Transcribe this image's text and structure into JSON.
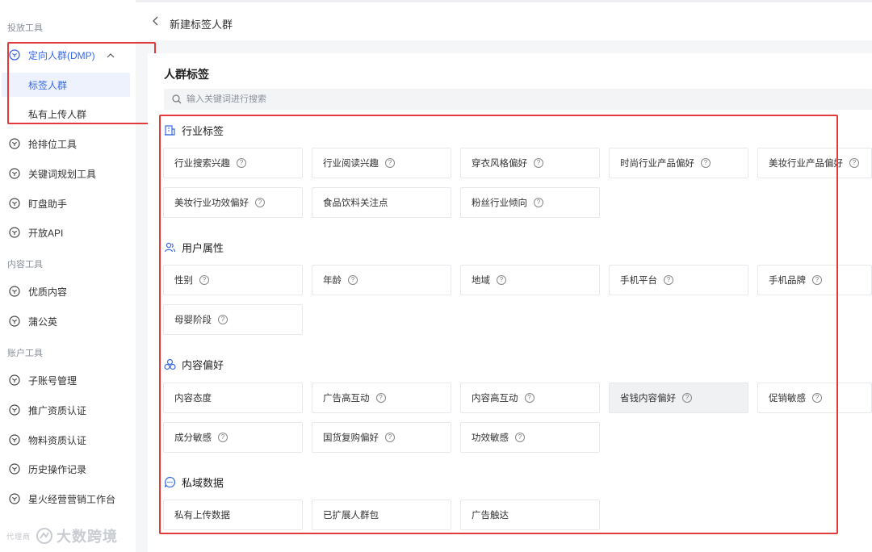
{
  "sidebar": {
    "section_ad": "投放工具",
    "dmp": "定向人群(DMP)",
    "sub_tags": "标签人群",
    "sub_upload": "私有上传人群",
    "rank_tool": "抢排位工具",
    "keyword_tool": "关键词规划工具",
    "monitor": "盯盘助手",
    "open_api": "开放API",
    "section_content": "内容工具",
    "quality": "优质内容",
    "pugongying": "蒲公英",
    "section_account": "账户工具",
    "sub_account": "子账号管理",
    "promo_cert": "推广资质认证",
    "material_cert": "物料资质认证",
    "history": "历史操作记录",
    "spark": "星火经营营销工作台",
    "footer_partial": "代理商",
    "watermark": "大数跨境"
  },
  "header": {
    "back_icon": "chevron-left-icon",
    "title": "新建标签人群"
  },
  "panel": {
    "title": "人群标签",
    "search_placeholder": "输入关键词进行搜索",
    "groups": {
      "industry": {
        "title": "行业标签",
        "tags": [
          "行业搜索兴趣",
          "行业阅读兴趣",
          "穿衣风格偏好",
          "时尚行业产品偏好",
          "美妆行业产品偏好",
          "美妆行业功效偏好",
          "食品饮料关注点",
          "粉丝行业倾向"
        ]
      },
      "user": {
        "title": "用户属性",
        "tags": [
          "性别",
          "年龄",
          "地域",
          "手机平台",
          "手机品牌",
          "母婴阶段"
        ]
      },
      "content": {
        "title": "内容偏好",
        "tags": [
          "内容态度",
          "广告高互动",
          "内容高互动",
          "省钱内容偏好",
          "促销敏感",
          "成分敏感",
          "国货复购偏好",
          "功效敏感"
        ]
      },
      "private": {
        "title": "私域数据",
        "tags": [
          "私有上传数据",
          "已扩展人群包",
          "广告触达"
        ]
      }
    },
    "help_mark": "?"
  },
  "colors": {
    "accent": "#3768e8",
    "highlight": "#e03a3a",
    "selected_bg": "#eef2fd"
  }
}
